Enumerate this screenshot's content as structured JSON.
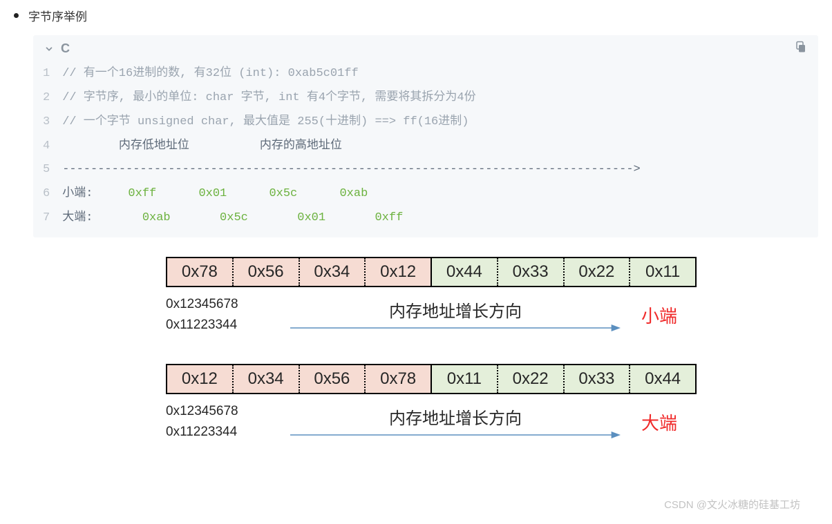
{
  "bullet": {
    "text": "字节序举例"
  },
  "code": {
    "language": "C",
    "lines": [
      {
        "n": "1",
        "segments": [
          {
            "cls": "cmt",
            "t": "// 有一个16进制的数, 有32位 (int): 0xab5c01ff"
          }
        ]
      },
      {
        "n": "2",
        "segments": [
          {
            "cls": "cmt",
            "t": "// 字节序, 最小的单位: char 字节, int 有4个字节, 需要将其拆分为4份"
          }
        ]
      },
      {
        "n": "3",
        "segments": [
          {
            "cls": "cmt",
            "t": "// 一个字节 unsigned char, 最大值是 255(十进制) ==> ff(16进制)"
          }
        ]
      },
      {
        "n": "4",
        "segments": [
          {
            "cls": "",
            "t": "        内存低地址位          内存的高地址位"
          }
        ]
      },
      {
        "n": "5",
        "segments": [
          {
            "cls": "",
            "t": "--------------------------------------------------------------------------------->"
          }
        ]
      },
      {
        "n": "6",
        "segments": [
          {
            "cls": "",
            "t": "小端:     "
          },
          {
            "cls": "grn",
            "t": "0xff      0x01      0x5c      0xab"
          }
        ]
      },
      {
        "n": "7",
        "segments": [
          {
            "cls": "",
            "t": "大端:       "
          },
          {
            "cls": "grn",
            "t": "0xab       0x5c       0x01       0xff"
          }
        ]
      }
    ]
  },
  "diagram": {
    "rows": [
      {
        "cells": [
          {
            "v": "0x78",
            "color": "pink"
          },
          {
            "v": "0x56",
            "color": "pink"
          },
          {
            "v": "0x34",
            "color": "pink"
          },
          {
            "v": "0x12",
            "color": "pink",
            "solid": true
          },
          {
            "v": "0x44",
            "color": "green"
          },
          {
            "v": "0x33",
            "color": "green"
          },
          {
            "v": "0x22",
            "color": "green"
          },
          {
            "v": "0x11",
            "color": "green"
          }
        ],
        "vals": [
          "0x12345678",
          "0x11223344"
        ],
        "arrow_label": "内存地址增长方向",
        "endian": "小端"
      },
      {
        "cells": [
          {
            "v": "0x12",
            "color": "pink"
          },
          {
            "v": "0x34",
            "color": "pink"
          },
          {
            "v": "0x56",
            "color": "pink"
          },
          {
            "v": "0x78",
            "color": "pink",
            "solid": true
          },
          {
            "v": "0x11",
            "color": "green"
          },
          {
            "v": "0x22",
            "color": "green"
          },
          {
            "v": "0x33",
            "color": "green"
          },
          {
            "v": "0x44",
            "color": "green"
          }
        ],
        "vals": [
          "0x12345678",
          "0x11223344"
        ],
        "arrow_label": "内存地址增长方向",
        "endian": "大端"
      }
    ]
  },
  "watermark": "CSDN @文火冰糖的硅基工坊"
}
